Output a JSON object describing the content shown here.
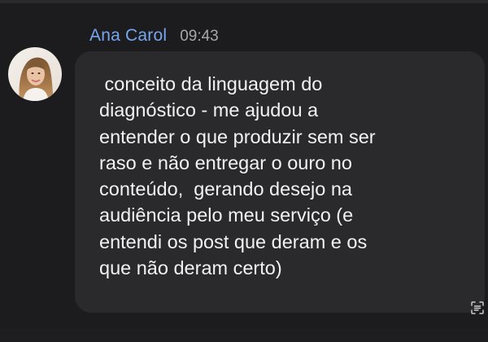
{
  "message": {
    "sender_name": "Ana Carol",
    "timestamp": "09:43",
    "text": " conceito da linguagem do\ndiagnóstico - me ajudou a\nentender o que produzir sem ser\nraso e não entregar o ouro no\nconteúdo,  gerando desejo na\naudiência pelo meu serviço (e\nentendi os post que deram e os\nque não deram certo)"
  },
  "icons": {
    "avatar": "profile-photo",
    "action": "text-recognition-icon"
  },
  "colors": {
    "background": "#1c1c1e",
    "bubble": "#2a2a2d",
    "sender_name": "#76a7ee",
    "timestamp": "#a7a7ab",
    "text": "#f2f2f4"
  }
}
